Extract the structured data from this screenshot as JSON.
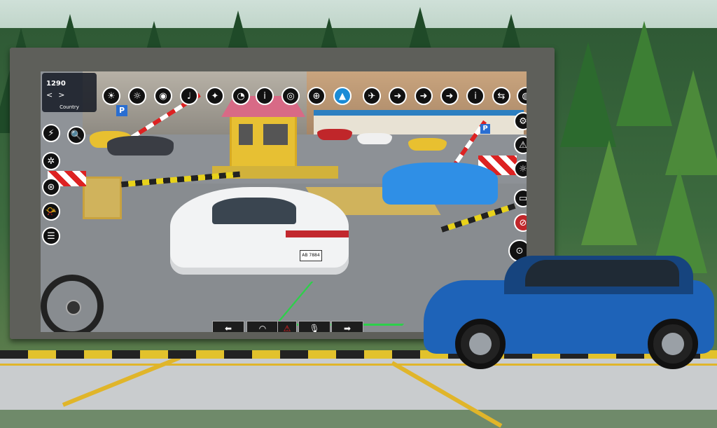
{
  "hud": {
    "coins": "1290",
    "country_label": "Country",
    "country_prev": "<",
    "country_next": ">"
  },
  "car": {
    "plate": "AB 7884"
  },
  "bottom_controls": {
    "left": "⬅",
    "speedo": "◠",
    "hazard": "⚠",
    "mic": "🎙",
    "right": "➡"
  },
  "top_icons": [
    "☀",
    "☼",
    "◉",
    "♩",
    "✦",
    "◐",
    "◔",
    "i",
    "◎",
    "⊕",
    "▲",
    "✈",
    "➜",
    "i",
    "⇆",
    "◍"
  ],
  "left_icons": [
    "⚡",
    "🔍",
    "✲",
    "⊛",
    "📯",
    "☰"
  ],
  "right_icons": [
    "⚙",
    "⚠",
    "☼",
    "▭",
    "⊘",
    "⊙"
  ],
  "sign": "P",
  "colors": {
    "suv": "#1e63b8",
    "white_car": "#f2f3f4",
    "blue_car": "#2f8fe6",
    "booth": "#e7c033",
    "roof": "#d86a86"
  }
}
